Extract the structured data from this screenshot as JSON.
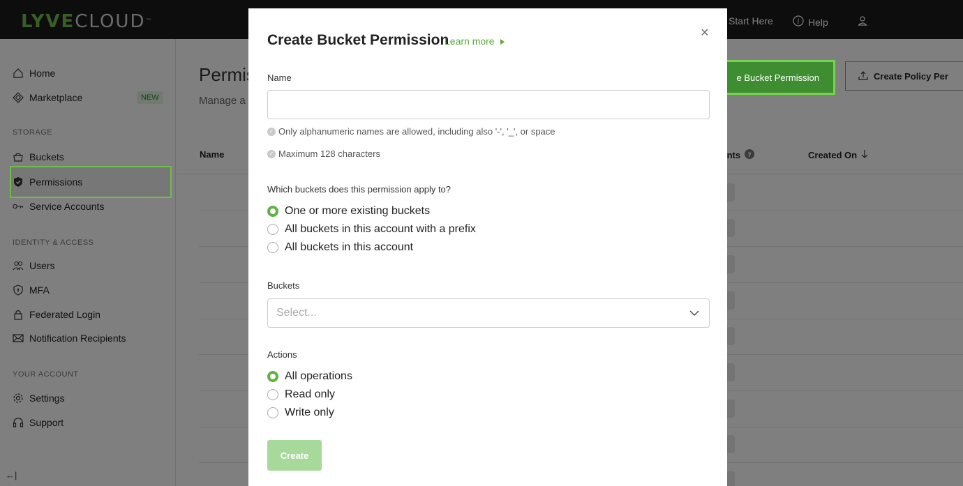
{
  "app": {
    "logo_primary": "LYVE",
    "logo_secondary": "CLOUD",
    "logo_tm": "™"
  },
  "topnav": {
    "start_here": "Start Here",
    "help": "Help"
  },
  "sidebar": {
    "items": [
      {
        "label": "Home",
        "icon": "home-icon"
      },
      {
        "label": "Marketplace",
        "icon": "marketplace-icon",
        "badge": "NEW"
      },
      {
        "label": "Buckets",
        "icon": "bucket-icon"
      },
      {
        "label": "Permissions",
        "icon": "shield-icon",
        "active": true
      },
      {
        "label": "Service Accounts",
        "icon": "key-icon"
      },
      {
        "label": "Users",
        "icon": "users-icon"
      },
      {
        "label": "MFA",
        "icon": "mfa-shield-icon"
      },
      {
        "label": "Federated Login",
        "icon": "lock-icon"
      },
      {
        "label": "Notification Recipients",
        "icon": "mail-icon"
      },
      {
        "label": "Settings",
        "icon": "gear-icon"
      },
      {
        "label": "Support",
        "icon": "headset-icon"
      }
    ],
    "sections": {
      "storage": "STORAGE",
      "identity": "IDENTITY & ACCESS",
      "account": "YOUR ACCOUNT"
    },
    "collapse_glyph": "←|"
  },
  "main": {
    "title_partial": "Permis",
    "subtitle_partial": "Manage a",
    "create_bucket_btn": "e Bucket Permission",
    "create_policy_btn": "Create Policy Per",
    "table": {
      "col_name": "Name",
      "col_accounts_partial": "ınts",
      "col_created": "Created On"
    }
  },
  "modal": {
    "title": "Create Bucket Permission",
    "learn_more": "Learn more",
    "close_glyph": "×",
    "name_label": "Name",
    "name_value": "",
    "hint_alnum": "Only alphanumeric names are allowed, including also '-', '_', or space",
    "hint_max": "Maximum 128 characters",
    "apply_question": "Which buckets does this permission apply to?",
    "apply_options": [
      {
        "label": "One or more existing buckets",
        "selected": true
      },
      {
        "label": "All buckets in this account with a prefix",
        "selected": false
      },
      {
        "label": "All buckets in this account",
        "selected": false
      }
    ],
    "buckets_label": "Buckets",
    "buckets_placeholder": "Select...",
    "actions_label": "Actions",
    "action_options": [
      {
        "label": "All operations",
        "selected": true
      },
      {
        "label": "Read only",
        "selected": false
      },
      {
        "label": "Write only",
        "selected": false
      }
    ],
    "create_btn": "Create"
  },
  "colors": {
    "brand_green": "#6ebe4a",
    "button_green": "#3f8d31",
    "highlight_border": "#78d150",
    "disabled_create": "#a7d99a"
  }
}
